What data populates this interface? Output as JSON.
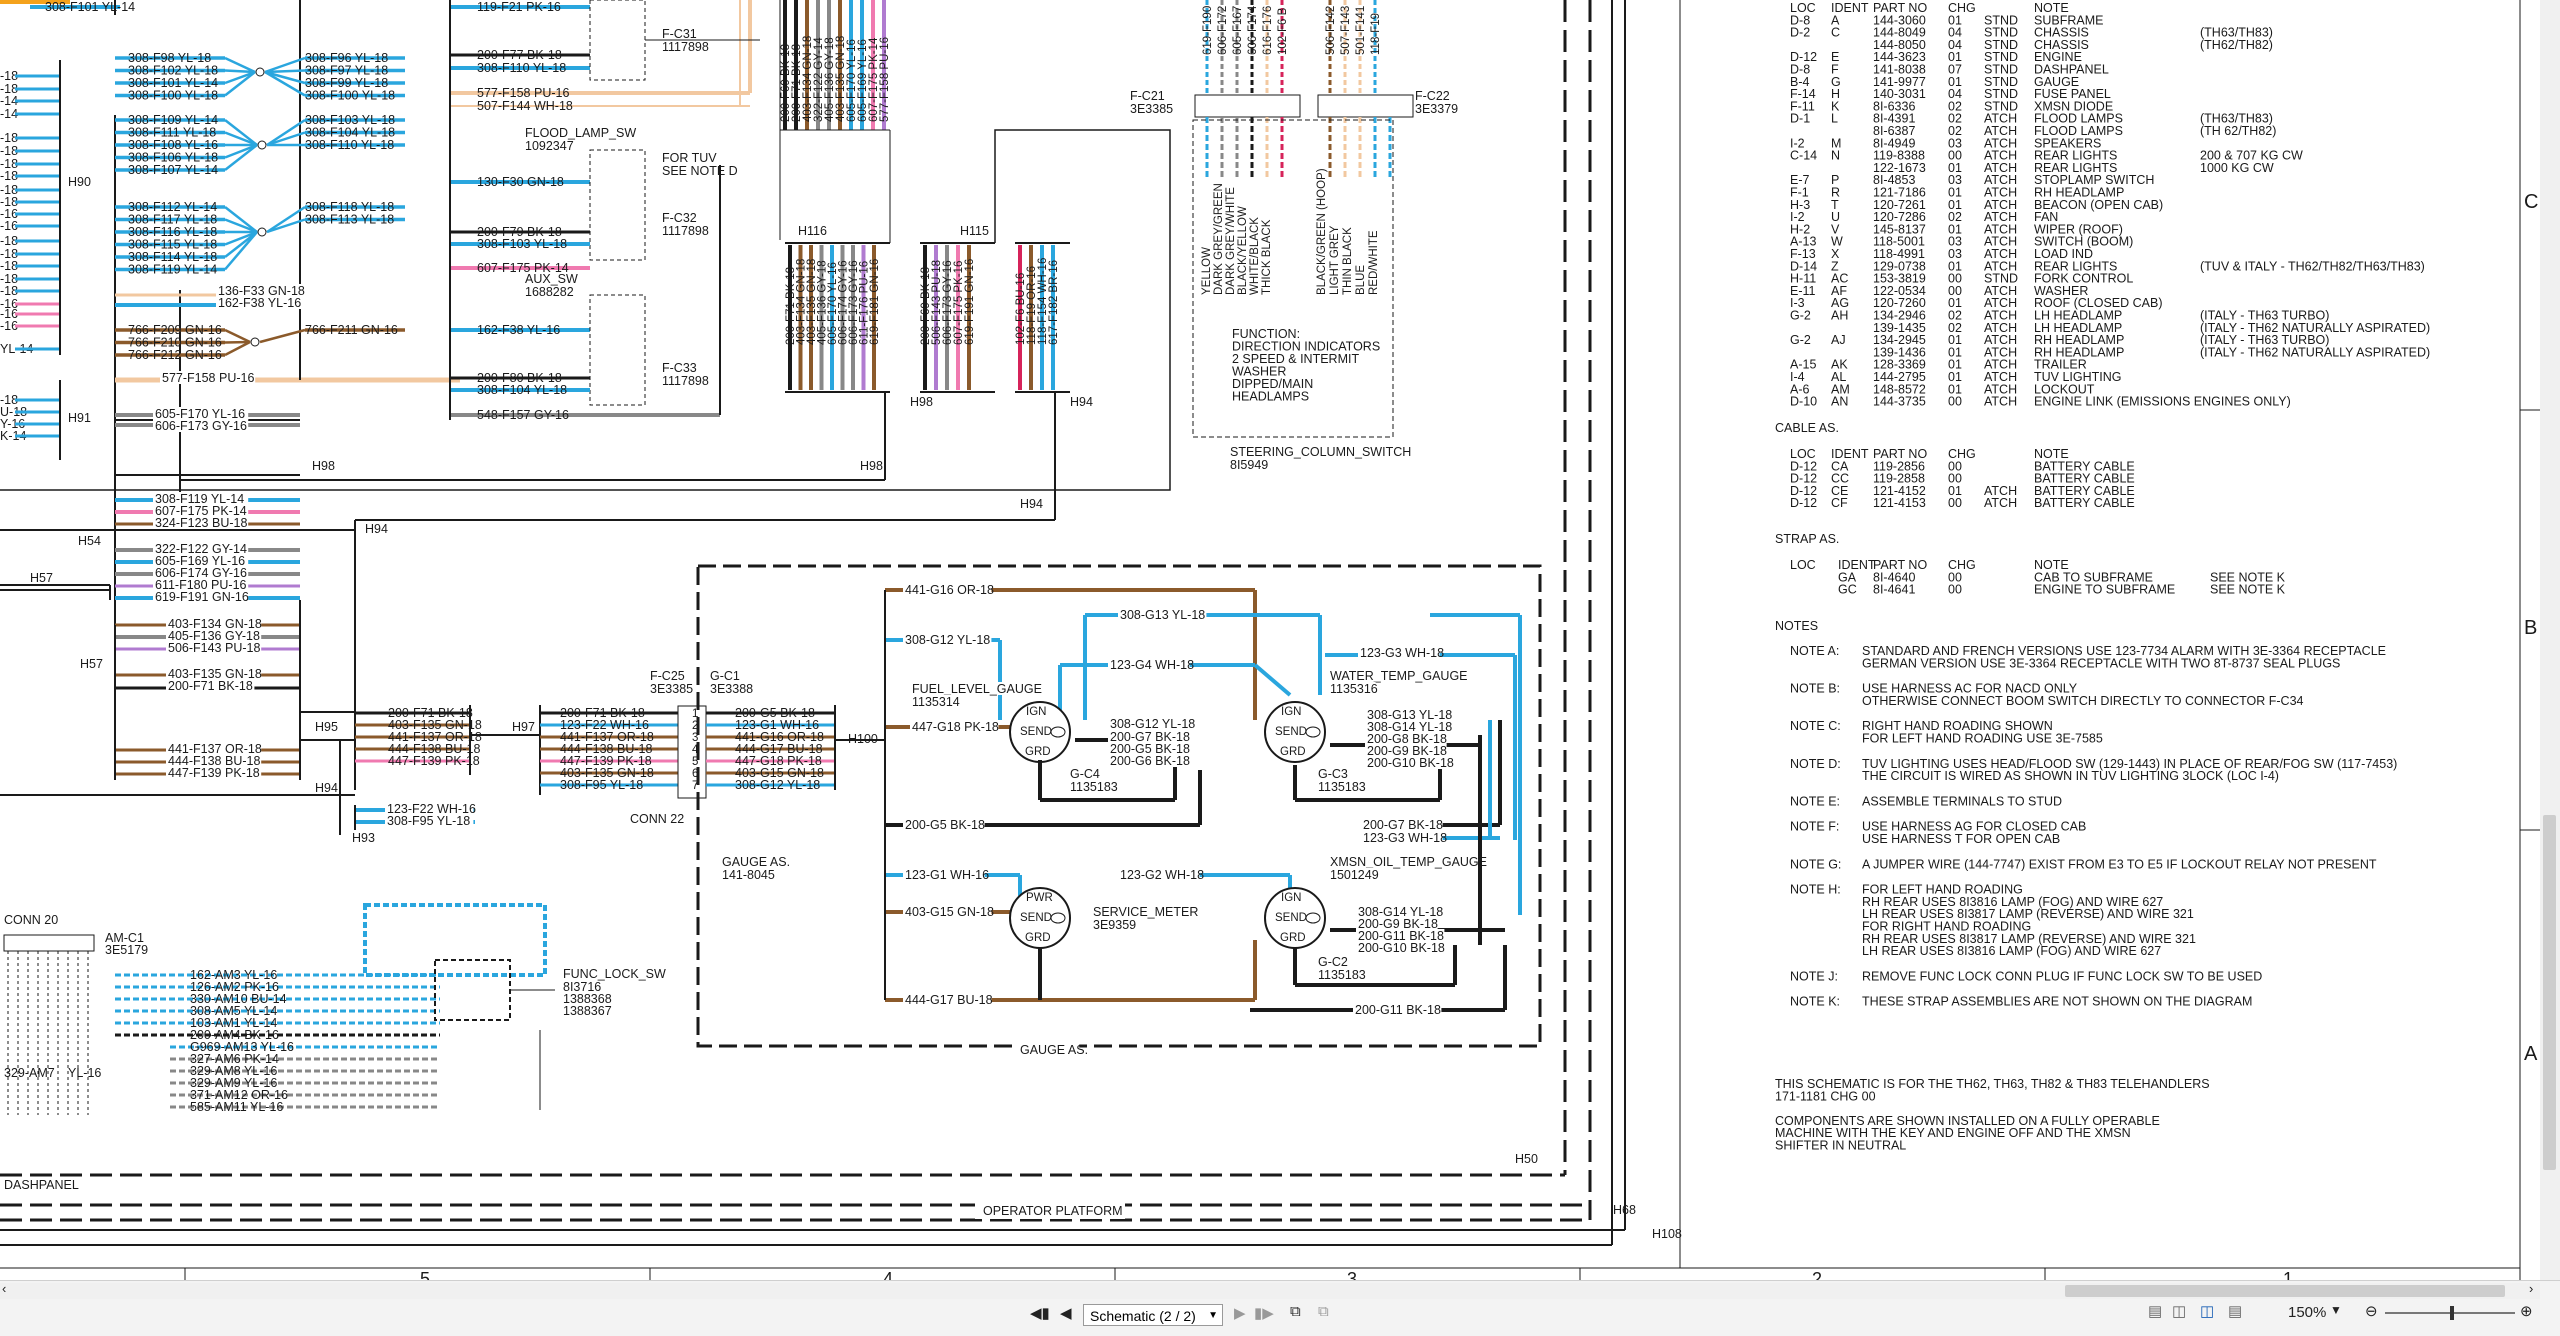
{
  "top_labels": {
    "f101": "308-F101 YL-14",
    "f21": "119-F21 PK-16"
  },
  "splices": {
    "g1": {
      "left": [
        "308-F98 YL-18",
        "308-F102 YL-18",
        "308-F101 YL-14",
        "308-F100 YL-18"
      ],
      "right": [
        "308-F96 YL-18",
        "308-F97 YL-18",
        "308-F99 YL-18",
        "308-F100 YL-18"
      ]
    },
    "g2": {
      "left": [
        "308-F109 YL-14",
        "308-F111 YL-18",
        "308-F108 YL-16",
        "308-F106 YL-18",
        "308-F107 YL-14"
      ],
      "right": [
        "308-F103 YL-18",
        "308-F104 YL-18",
        "308-F110 YL-18"
      ]
    },
    "g3": {
      "left": [
        "308-F112 YL-14",
        "308-F117 YL-18",
        "308-F116 YL-18",
        "308-F115 YL-18",
        "308-F114 YL-18",
        "308-F119 YL-14"
      ],
      "right": [
        "308-F118 YL-18",
        "308-F113 YL-18"
      ]
    },
    "g4": {
      "left": [
        "766-F209 GN-16",
        "766-F210 GN-16",
        "766-F212 GN-16"
      ],
      "right": [
        "766-F211 GN-16"
      ]
    }
  },
  "left_edge": [
    "-18",
    "-18",
    "-14",
    "-14",
    "-18",
    "-18",
    "-18",
    "-18",
    "-18",
    "-18",
    "-16",
    "-16",
    "-18",
    "-18",
    "-18",
    "-18",
    "-18",
    "-16",
    "-16",
    "-16",
    "-18",
    "U-18",
    "Y-16",
    "K-14",
    "YL-14"
  ],
  "h_labels": {
    "h90": "H90",
    "h91": "H91",
    "h98a": "H98",
    "h98b": "H98",
    "h54": "H54",
    "h57a": "H57",
    "h57b": "H57",
    "h94a": "H94",
    "h94b": "H94",
    "h94c": "H94",
    "h95": "H95",
    "h97": "H97",
    "h93": "H93",
    "h116": "H116",
    "h115": "H115",
    "h98c": "H98",
    "h94d": "H94",
    "h100": "H100",
    "h50": "H50",
    "h68": "H68",
    "h108": "H108"
  },
  "mid_wires": {
    "f33": "136-F33 GN-18",
    "f38": "162-F38 YL-16",
    "f158": "577-F158 PU-16",
    "f170": "605-F170 YL-16",
    "f173": "606-F173 GY-16",
    "f119b": "308-F119 YL-14",
    "f175": "607-F175 PK-14",
    "f123": "324-F123 BU-18",
    "f122": "322-F122 GY-14",
    "f169": "605-F169 YL-16",
    "f174": "606-F174 GY-16",
    "f176": "611-F180 PU-16",
    "f181": "619-F191 GN-16",
    "f134": "403-F134 GN-18",
    "f136": "405-F136 GY-18",
    "f143": "506-F143 PU-18",
    "f135": "403-F135 GN-18",
    "f71": "200-F71 BK-18",
    "f137": "441-F137 OR-18",
    "f138": "444-F138 BU-18",
    "f139": "447-F139 PK-18",
    "f22": "123-F22 WH-16",
    "f95": "308-F95 YL-18"
  },
  "conn_block_left": [
    "200-F71 BK-18",
    "403-F135 GN-18",
    "441-F137 OR-18",
    "444-F138 BU-18",
    "447-F139 PK-18"
  ],
  "conn_block_mid": [
    "200-F71 BK-18",
    "123-F22 WH-16",
    "441-F137 OR-18",
    "444-F138 BU-18",
    "447-F139 PK-18",
    "403-F135 GN-18",
    "308-F95 YL-18"
  ],
  "conn_block_right": [
    "200-G5 BK-18",
    "123-G1 WH-16",
    "441-G16 OR-18",
    "444-G17 BU-18",
    "447-G18 PK-18",
    "403-G15 GN-18",
    "308-G12 YL-18"
  ],
  "conn22": {
    "f_c25": "F-C25",
    "f_c25_pn": "3E3385",
    "g_c1": "G-C1",
    "g_c1_pn": "3E3388",
    "name": "CONN 22",
    "pins": [
      "1",
      "2",
      "3",
      "4",
      "5",
      "6",
      "7"
    ]
  },
  "flood_lamp": {
    "c31": "F-C31",
    "c31_pn": "1117898",
    "f77": "200-F77 BK-18",
    "f110": "308-F110 YL-18",
    "f158b": "577-F158 PU-16",
    "f144": "507-F144 WH-18",
    "sw": "FLOOD_LAMP_SW",
    "sw_pn": "1092347",
    "f30": "130-F30 GN-18",
    "tuv1": "FOR TUV",
    "tuv2": "SEE NOTE D",
    "c32": "F-C32",
    "c32_pn": "1117898",
    "f79": "200-F79 BK-18",
    "f103": "308-F103 YL-18",
    "f175b": "607-F175 PK-14",
    "aux": "AUX_SW",
    "aux_pn": "1688282",
    "f38b": "162-F38 YL-16",
    "c33": "F-C33",
    "c33_pn": "1117898",
    "f80": "200-F80 BK-18",
    "f104": "308-F104 YL-18",
    "f157": "548-F157 GY-16"
  },
  "h116_wires_top": [
    "200-F69 BK-18",
    "200-F71 BK-18",
    "403-F134 GN-18",
    "322-F122 GY-14",
    "405-F136 GY-18",
    "403-F135 GN-18",
    "605-F170 YL-16",
    "605-F169 YL-16",
    "607-F175 PK-14",
    "577-F158 PU-16"
  ],
  "h116_wires_bot": [
    "200-F71 BK-18",
    "403-F134 GN-18",
    "403-F135 GN-18",
    "405-F136 GY-18",
    "605-F170 YL-16",
    "606-F174 GY-16",
    "606-F173 GY-16",
    "611-F176 PU-16",
    "619-F181 GN-16"
  ],
  "h115_wires": [
    "200-F69 BK-18",
    "506-F143 PU-18",
    "606-F173 GY-16",
    "607-F175 PK-16",
    "619-F191 GN-16"
  ],
  "h94_wires": [
    "102-F6 BU-16",
    "118-F19 OR-16",
    "118-F154 WH-16",
    "617-F182 BR-16"
  ],
  "steering": {
    "c21": "F-C21",
    "c21_pn": "3E3385",
    "c22": "F-C22",
    "c22_pn": "3E3379",
    "top_left": [
      "619-F190",
      "606-F172",
      "605-F167",
      "606-F174",
      "616-F176",
      "102-F6 B"
    ],
    "top_right": [
      "506-F142",
      "507-F143",
      "501-F141",
      "118-F19"
    ],
    "colors_left": [
      "YELLOW",
      "DARK GREY/GREEN",
      "DARK GREY/WHITE",
      "BLACK/YELLOW",
      "WHITE/BLACK",
      "THICK BLACK"
    ],
    "colors_right": [
      "BLACK/GREEN (HOOP)",
      "LIGHT GREY",
      "THIN BLACK",
      "BLUE",
      "RED/WHITE"
    ],
    "function_lines": [
      "FUNCTION:",
      "DIRECTION INDICATORS",
      "2 SPEED & INTERMIT",
      "WASHER",
      "DIPPED/MAIN",
      "HEADLAMPS"
    ],
    "name": "STEERING_COLUMN_SWITCH",
    "pn": "8I5949"
  },
  "gauges": {
    "g16": "441-G16 OR-18",
    "g12": "308-G12 YL-18",
    "g13": "308-G13 YL-18",
    "g4": "123-G4 WH-18",
    "g3": "123-G3 WH-18",
    "fuel": "FUEL_LEVEL_GAUGE",
    "fuel_pn": "1135314",
    "water": "WATER_TEMP_GAUGE",
    "water_pn": "1135316",
    "g18": "447-G18 PK-18",
    "g12b": "308-G12 YL-18",
    "g7": "200-G7 BK-18",
    "g5": "200-G5 BK-18",
    "g6": "200-G6 BK-18",
    "g13b": "308-G13 YL-18",
    "g14": "308-G14 YL-18",
    "g8": "200-G8 BK-18",
    "g9": "200-G9 BK-18",
    "g10": "200-G10 BK-18",
    "gc4": "G-C4",
    "gc4_pn": "1135183",
    "gc3": "G-C3",
    "gc3_pn": "1135183",
    "g5b": "200-G5 BK-18",
    "g7b": "200-G7 BK-18",
    "g13c": "123-G3 WH-18",
    "xmsn": "XMSN_OIL_TEMP_GAUGE",
    "xmsn_pn": "1501249",
    "g1": "123-G1 WH-16",
    "g2": "123-G2 WH-18",
    "g15": "403-G15 GN-18",
    "svc": "SERVICE_METER",
    "svc_pn": "3E9359",
    "g14b": "308-G14 YL-18",
    "g9b": "200-G9 BK-18",
    "g11": "200-G11 BK-18",
    "g10b": "200-G10 BK-18",
    "gc2": "G-C2",
    "gc2_pn": "1135183",
    "g17": "444-G17 BU-18",
    "g11b": "200-G11 BK-18",
    "as_name": "GAUGE AS.",
    "as_pn": "141-8045",
    "as_bottom": "GAUGE AS.",
    "ign": "IGN",
    "send": "SEND",
    "grd": "GRD",
    "pwr": "PWR"
  },
  "func_lock": {
    "conn": "CONN 20",
    "am": "AM-C1",
    "am_pn": "3E5179",
    "wires": [
      "162-AM3 YL-16",
      "126-AM2 PK-16",
      "330-AM10 BU-14",
      "308-AM5 YL-14",
      "103-AM1 YL-14",
      "200-AM4 BK-16",
      "G969-AM13 YL-16",
      "327-AM6 PK-14",
      "329-AM8 YL-16",
      "329-AM9 YL-16",
      "371-AM12 OR-16",
      "585-AM11 YL-16"
    ],
    "am7": "329-AM7",
    "am7b": "YL-16",
    "name": "FUNC_LOCK_SW",
    "pn1": "8I3716",
    "pn2": "1388368",
    "pn3": "1388367"
  },
  "frame_labels": {
    "dash": "DASHPANEL",
    "op": "OPERATOR PLATFORM"
  },
  "table1_rows": [
    [
      "LOC",
      "IDENT",
      "PART NO",
      "CHG",
      "",
      "NOTE",
      ""
    ],
    [
      "D-8",
      "A",
      "144-3060",
      "01",
      "STND",
      "SUBFRAME",
      ""
    ],
    [
      "D-2",
      "C",
      "144-8049",
      "04",
      "STND",
      "CHASSIS",
      "(TH63/TH83)"
    ],
    [
      "",
      "",
      "144-8050",
      "04",
      "STND",
      "CHASSIS",
      "(TH62/TH82)"
    ],
    [
      "D-12",
      "E",
      "144-3623",
      "01",
      "STND",
      "ENGINE",
      ""
    ],
    [
      "D-8",
      "F",
      "141-8038",
      "07",
      "STND",
      "DASHPANEL",
      ""
    ],
    [
      "B-4",
      "G",
      "141-9977",
      "01",
      "STND",
      "GAUGE",
      ""
    ],
    [
      "F-14",
      "H",
      "140-3031",
      "04",
      "STND",
      "FUSE PANEL",
      ""
    ],
    [
      "F-11",
      "K",
      "8I-6336",
      "02",
      "STND",
      "XMSN DIODE",
      ""
    ],
    [
      "D-1",
      "L",
      "8I-4391",
      "02",
      "ATCH",
      "FLOOD LAMPS",
      "(TH63/TH83)"
    ],
    [
      "",
      "",
      "8I-6387",
      "02",
      "ATCH",
      "FLOOD LAMPS",
      "(TH 62/TH82)"
    ],
    [
      "I-2",
      "M",
      "8I-4949",
      "03",
      "ATCH",
      "SPEAKERS",
      ""
    ],
    [
      "C-14",
      "N",
      "119-8388",
      "00",
      "ATCH",
      "REAR LIGHTS",
      "200  & 707 KG CW"
    ],
    [
      "",
      "",
      "122-1673",
      "01",
      "ATCH",
      "REAR LIGHTS",
      "1000 KG CW"
    ],
    [
      "E-7",
      "P",
      "8I-4853",
      "03",
      "ATCH",
      "STOPLAMP SWITCH",
      ""
    ],
    [
      "F-1",
      "R",
      "121-7186",
      "01",
      "ATCH",
      "RH HEADLAMP",
      ""
    ],
    [
      "H-3",
      "T",
      "120-7261",
      "01",
      "ATCH",
      "BEACON  (OPEN CAB)",
      ""
    ],
    [
      "I-2",
      "U",
      "120-7286",
      "02",
      "ATCH",
      "FAN",
      ""
    ],
    [
      "H-2",
      "V",
      "145-8137",
      "01",
      "ATCH",
      "WIPER (ROOF)",
      ""
    ],
    [
      "A-13",
      "W",
      "118-5001",
      "03",
      "ATCH",
      "SWITCH (BOOM)",
      ""
    ],
    [
      "F-13",
      "X",
      "118-4991",
      "03",
      "ATCH",
      "LOAD IND",
      ""
    ],
    [
      "D-14",
      "Z",
      "129-0738",
      "01",
      "ATCH",
      "REAR LIGHTS",
      "(TUV  & ITALY - TH62/TH82/TH63/TH83)"
    ],
    [
      "H-11",
      "AC",
      "153-3819",
      "00",
      "STND",
      "FORK CONTROL",
      ""
    ],
    [
      "E-11",
      "AF",
      "122-0534",
      "00",
      "ATCH",
      "WASHER",
      ""
    ],
    [
      "I-3",
      "AG",
      "120-7260",
      "01",
      "ATCH",
      "ROOF    (CLOSED CAB)",
      ""
    ],
    [
      "G-2",
      "AH",
      "134-2946",
      "02",
      "ATCH",
      "LH HEADLAMP",
      "(ITALY - TH63 TURBO)"
    ],
    [
      "",
      "",
      "139-1435",
      "02",
      "ATCH",
      "LH HEADLAMP",
      "(ITALY - TH62 NATURALLY ASPIRATED)"
    ],
    [
      "G-2",
      "AJ",
      "134-2945",
      "01",
      "ATCH",
      "RH HEADLAMP",
      "(ITALY - TH63 TURBO)"
    ],
    [
      "",
      "",
      "139-1436",
      "01",
      "ATCH",
      "RH HEADLAMP",
      "(ITALY - TH62 NATURALLY ASPIRATED)"
    ],
    [
      "A-15",
      "AK",
      "128-3369",
      "01",
      "ATCH",
      "TRAILER",
      ""
    ],
    [
      "I-4",
      "AL",
      "144-2795",
      "01",
      "ATCH",
      "TUV LIGHTING",
      ""
    ],
    [
      "A-6",
      "AM",
      "148-8572",
      "01",
      "ATCH",
      "LOCKOUT",
      ""
    ],
    [
      "D-10",
      "AN",
      "144-3735",
      "00",
      "ATCH",
      "ENGINE LINK (EMISSIONS ENGINES ONLY)",
      ""
    ]
  ],
  "cable_title": "CABLE AS.",
  "cable_rows": [
    [
      "LOC",
      "IDENT",
      "PART NO",
      "CHG",
      "",
      "NOTE"
    ],
    [
      "D-12",
      "CA",
      "119-2856",
      "00",
      "",
      "BATTERY CABLE"
    ],
    [
      "D-12",
      "CC",
      "119-2858",
      "00",
      "",
      "BATTERY CABLE"
    ],
    [
      "D-12",
      "CE",
      "121-4152",
      "01",
      "ATCH",
      "BATTERY CABLE"
    ],
    [
      "D-12",
      "CF",
      "121-4153",
      "00",
      "ATCH",
      "BATTERY CABLE"
    ]
  ],
  "strap_title": "STRAP AS.",
  "strap_rows": [
    [
      "LOC",
      "IDENT",
      "PART NO",
      "CHG",
      "NOTE",
      ""
    ],
    [
      "",
      "GA",
      "8I-4640",
      "00",
      "CAB TO SUBFRAME",
      "SEE NOTE K"
    ],
    [
      "",
      "GC",
      "8I-4641",
      "00",
      "ENGINE TO SUBFRAME",
      "SEE NOTE K"
    ]
  ],
  "notes_title": "NOTES",
  "notes": [
    {
      "label": "NOTE A:",
      "lines": [
        "STANDARD AND FRENCH VERSIONS USE 123-7734 ALARM WITH 3E-3364  RECEPTACLE",
        "GERMAN VERSION USE 3E-3364 RECEPTACLE WITH TWO 8T-8737 SEAL PLUGS"
      ]
    },
    {
      "label": "NOTE B:",
      "lines": [
        "USE HARNESS AC FOR NACD ONLY",
        "OTHERWISE CONNECT BOOM SWITCH DIRECTLY TO CONNECTOR F-C34"
      ]
    },
    {
      "label": "NOTE C:",
      "lines": [
        "RIGHT HAND ROADING SHOWN",
        "FOR LEFT HAND ROADING USE 3E-7585"
      ]
    },
    {
      "label": "NOTE D:",
      "lines": [
        "TUV LIGHTING USES HEAD/FLOOD SW (129-1443) IN PLACE OF REAR/FOG SW (117-7453)",
        "THE CIRCUIT IS WIRED AS SHOWN IN TUV LIGHTING 3LOCK (LOC I-4)"
      ]
    },
    {
      "label": "NOTE E:",
      "lines": [
        "ASSEMBLE TERMINALS TO STUD"
      ]
    },
    {
      "label": "NOTE F:",
      "lines": [
        "USE HARNESS AG FOR CLOSED CAB",
        "USE HARNESS T FOR OPEN CAB"
      ]
    },
    {
      "label": "NOTE G:",
      "lines": [
        "A JUMPER WIRE (144-7747) EXIST FROM E3 TO E5 IF LOCKOUT RELAY NOT PRESENT"
      ]
    },
    {
      "label": "NOTE H:",
      "lines": [
        "FOR LEFT HAND ROADING",
        "     RH REAR USES 8I3816 LAMP (FOG) AND WIRE 627",
        "     LH REAR USES 8I3817 LAMP (REVERSE) AND WIRE 321",
        "FOR RIGHT HAND ROADING",
        "     RH REAR USES 8I3817 LAMP (REVERSE) AND WIRE 321",
        "     LH REAR USES 8I3816 LAMP (FOG) AND WIRE 627"
      ]
    },
    {
      "label": "NOTE J:",
      "lines": [
        "REMOVE FUNC LOCK CONN PLUG IF FUNC LOCK SW TO BE USED"
      ]
    },
    {
      "label": "NOTE K:",
      "lines": [
        "THESE STRAP ASSEMBLIES ARE NOT SHOWN ON THE DIAGRAM"
      ]
    }
  ],
  "footer_lines": [
    "THIS SCHEMATIC IS FOR THE TH62, TH63, TH82 & TH83 TELEHANDLERS",
    "171-1181 CHG 00",
    "",
    "COMPONENTS ARE SHOWN INSTALLED ON A FULLY OPERABLE",
    "MACHINE WITH THE KEY AND ENGINE OFF AND THE XMSN",
    "SHIFTER IN NEUTRAL"
  ],
  "grid_letters": [
    "C",
    "B",
    "A"
  ],
  "grid_numbers": [
    "5",
    "4",
    "3",
    "2",
    "1"
  ],
  "status": {
    "page_label": "Schematic (2 / 2)",
    "zoom": "150%"
  }
}
